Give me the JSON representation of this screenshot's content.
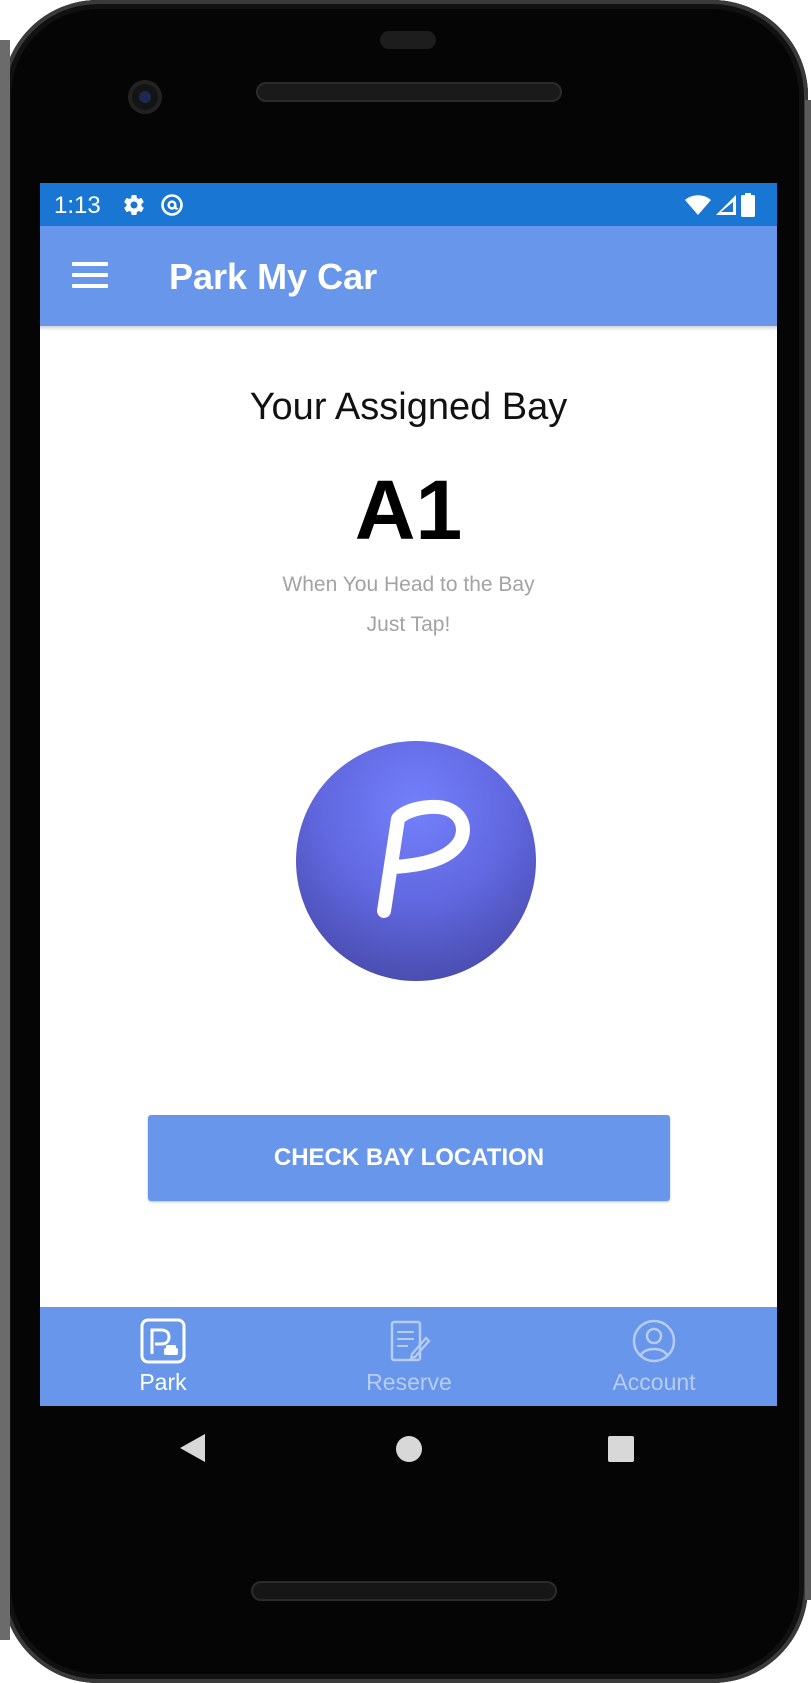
{
  "status_bar": {
    "time": "1:13",
    "icons_left": [
      "gear-icon",
      "at-sign-icon"
    ],
    "icons_right": [
      "wifi-icon",
      "signal-icon",
      "battery-icon"
    ],
    "color": "#1976d2"
  },
  "app_bar": {
    "title": "Park My Car",
    "menu_icon": "hamburger-menu-icon",
    "color": "#6796ea"
  },
  "main": {
    "heading": "Your Assigned Bay",
    "bay_code": "A1",
    "instruction_line1": "When You Head to the Bay",
    "instruction_line2": "Just Tap!",
    "tap_target": {
      "letter": "P",
      "icon": "parking-p-icon",
      "color": "#6168e0"
    },
    "check_button_label": "CHECK BAY LOCATION"
  },
  "bottom_nav": {
    "items": [
      {
        "label": "Park",
        "icon": "parking-car-icon",
        "active": true
      },
      {
        "label": "Reserve",
        "icon": "edit-document-icon",
        "active": false
      },
      {
        "label": "Account",
        "icon": "account-circle-icon",
        "active": false
      }
    ]
  },
  "system_nav": {
    "buttons": [
      "back-triangle-icon",
      "home-circle-icon",
      "recents-square-icon"
    ]
  }
}
